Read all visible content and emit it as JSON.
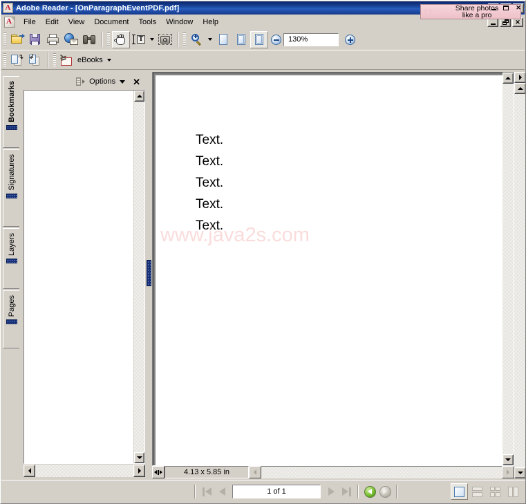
{
  "window": {
    "title": "Adobe Reader - [OnParagraphEventPDF.pdf]",
    "app_icon": "adobe-reader-icon",
    "outer_controls": [
      {
        "name": "minimize",
        "glyph": "minimize-icon"
      },
      {
        "name": "maximize",
        "glyph": "maximize-icon"
      },
      {
        "name": "close",
        "glyph": "close-icon",
        "label": "✕"
      }
    ],
    "child_controls": [
      {
        "name": "minimize",
        "glyph": "minimize-icon"
      },
      {
        "name": "restore",
        "glyph": "restore-icon"
      },
      {
        "name": "close",
        "glyph": "close-icon",
        "label": "✕"
      }
    ]
  },
  "menubar": {
    "icon": "acrobat-document-icon",
    "items": [
      {
        "label": "File"
      },
      {
        "label": "Edit"
      },
      {
        "label": "View"
      },
      {
        "label": "Document"
      },
      {
        "label": "Tools"
      },
      {
        "label": "Window"
      },
      {
        "label": "Help"
      }
    ]
  },
  "toolbar_row1": {
    "file_group": [
      {
        "name": "open-button",
        "icon": "open-folder-icon",
        "label": "Open"
      },
      {
        "name": "save-button",
        "icon": "save-floppy-icon",
        "label": "Save a Copy"
      },
      {
        "name": "print-button",
        "icon": "printer-icon",
        "label": "Print"
      },
      {
        "name": "email-button",
        "icon": "email-globe-icon",
        "label": "Email"
      },
      {
        "name": "search-button",
        "icon": "binoculars-icon",
        "label": "Search"
      }
    ],
    "tools_group": [
      {
        "name": "hand-tool",
        "icon": "hand-icon",
        "label": "Hand Tool",
        "active": true
      },
      {
        "name": "select-text-tool",
        "icon": "select-text-icon",
        "label": "Select Text",
        "has_dropdown": true
      },
      {
        "name": "snapshot-tool",
        "icon": "snapshot-camera-icon",
        "label": "Snapshot Tool"
      }
    ],
    "zoom_group": [
      {
        "name": "zoom-in-tool",
        "icon": "magnifier-plus-icon",
        "label": "Zoom In Tool",
        "has_dropdown": true
      },
      {
        "name": "actual-size-button",
        "icon": "page-actual-size-icon",
        "label": "Actual Size"
      },
      {
        "name": "fit-page-button",
        "icon": "page-fit-icon",
        "label": "Fit Page"
      },
      {
        "name": "fit-width-button",
        "icon": "page-fit-width-icon",
        "label": "Fit Width",
        "active": true
      }
    ],
    "zoom_out_label": "Zoom Out",
    "zoom_in_label": "Zoom In",
    "zoom_value": "130%",
    "zoom_dropdown_label": "Zoom level options"
  },
  "toolbar_row2": {
    "page_buttons": [
      {
        "name": "insert-pages-button",
        "icon": "insert-pages-icon",
        "label": "Insert Pages"
      },
      {
        "name": "extract-pages-button",
        "icon": "extract-pages-icon",
        "label": "Extract Pages"
      }
    ],
    "ebooks": {
      "name": "ebooks-button",
      "icon": "ebooks-icon",
      "label": "eBooks",
      "has_dropdown": true
    }
  },
  "promo": {
    "icon": "paper-plane-icon",
    "line1": "Share photos",
    "line2": "like a pro"
  },
  "navigation_tabs": [
    {
      "name": "tab-bookmarks",
      "label": "Bookmarks",
      "active": true
    },
    {
      "name": "tab-signatures",
      "label": "Signatures",
      "active": false
    },
    {
      "name": "tab-layers",
      "label": "Layers",
      "active": false
    },
    {
      "name": "tab-pages",
      "label": "Pages",
      "active": false
    }
  ],
  "nav_pane": {
    "options_icon": "options-panel-icon",
    "options_label": "Options",
    "options_caret": "chevron-down-icon",
    "close_label": "✕",
    "content": ""
  },
  "document": {
    "lines": [
      "Text.",
      "Text.",
      "Text.",
      "Text.",
      "Text."
    ],
    "watermark": "www.java2s.com",
    "watermark_color": "#fadcdc",
    "page_size": "4.13 x 5.85 in"
  },
  "statusbar": {
    "first_page_label": "First Page",
    "previous_page_label": "Previous Page",
    "page_value": "1 of 1",
    "next_page_label": "Next Page",
    "last_page_label": "Last Page",
    "previous_view_label": "Previous View",
    "next_view_label": "Next View",
    "view_modes": [
      {
        "name": "single-page-view-button",
        "label": "Single Page",
        "active": true
      },
      {
        "name": "continuous-view-button",
        "label": "Continuous",
        "active": false
      },
      {
        "name": "continuous-facing-view-button",
        "label": "Continuous - Facing",
        "active": false
      },
      {
        "name": "facing-view-button",
        "label": "Facing",
        "active": false
      }
    ]
  },
  "colors": {
    "titlebar_start": "#0a246a",
    "titlebar_end": "#15398c",
    "chrome": "#d4d0c8",
    "promo_bg": "#f0c8d0",
    "splitter": "#16307a"
  }
}
